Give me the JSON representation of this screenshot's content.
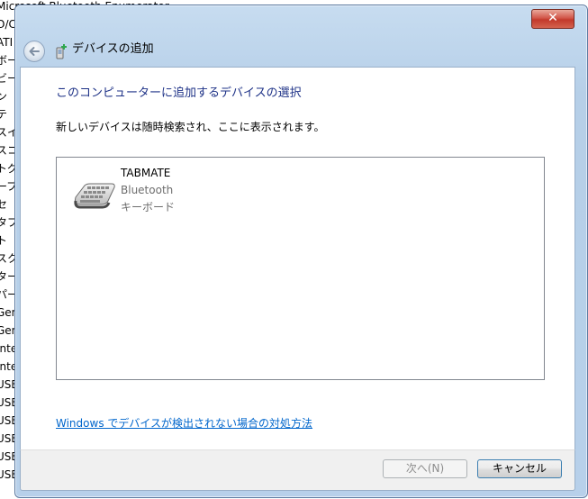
{
  "background": {
    "items": [
      "Microsoft Bluetooth Enumerator",
      "O/C",
      "ATI",
      "ボー",
      "ビー",
      "ン",
      "テ",
      "スイ",
      "スコ",
      "トグ",
      "ーブ",
      "セ",
      "タブ",
      "ト",
      "スク",
      "ター",
      "パー",
      "Gen",
      "Gen",
      "Inte",
      "Inte",
      "USB",
      "USB",
      "USB",
      "USB",
      "USB",
      "USB"
    ]
  },
  "dialog": {
    "close_label": "✕",
    "title": "デバイスの追加",
    "heading": "このコンピューターに追加するデバイスの選択",
    "subtext": "新しいデバイスは随時検索され、ここに表示されます。",
    "devices": [
      {
        "name": "TABMATE",
        "type": "Bluetooth",
        "category": "キーボード"
      }
    ],
    "help_link": "Windows でデバイスが検出されない場合の対処方法",
    "buttons": {
      "next": "次へ(N)",
      "cancel": "キャンセル"
    }
  },
  "icons": {
    "back": "back-arrow-icon",
    "title": "bluetooth-device-add-icon",
    "device": "keyboard-icon",
    "close": "close-icon"
  }
}
